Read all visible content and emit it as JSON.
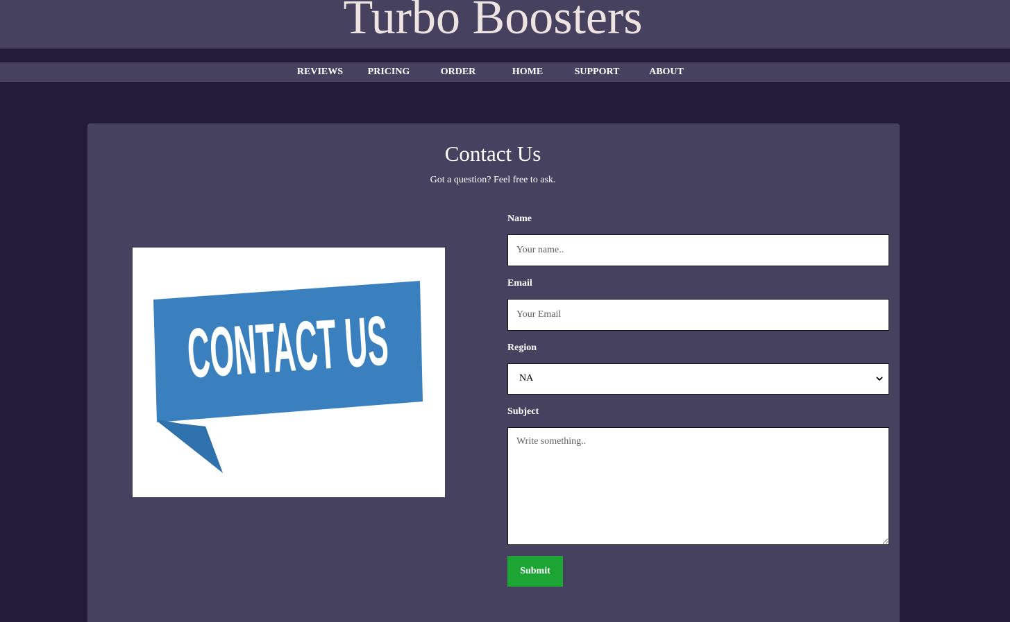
{
  "site": {
    "title": "Turbo Boosters"
  },
  "nav": {
    "items": [
      {
        "label": "REVIEWS"
      },
      {
        "label": "PRICING"
      },
      {
        "label": "ORDER"
      },
      {
        "label": "HOME"
      },
      {
        "label": "SUPPORT"
      },
      {
        "label": "ABOUT"
      }
    ]
  },
  "contact": {
    "title": "Contact Us",
    "subtitle": "Got a question? Feel free to ask.",
    "image_text": "CONTACT US",
    "form": {
      "name_label": "Name",
      "name_placeholder": "Your name..",
      "email_label": "Email",
      "email_placeholder": "Your Email",
      "region_label": "Region",
      "region_value": "NA",
      "subject_label": "Subject",
      "subject_placeholder": "Write something..",
      "submit_label": "Submit"
    }
  },
  "colors": {
    "page_background": "#221c38",
    "panel_background": "#474160",
    "title_text": "#ede3e0",
    "submit_button": "#1da534",
    "banner_blue": "#3a80bf",
    "banner_shadow": "#2a6aa3"
  },
  "icons": {
    "select": "chevron-down-icon"
  }
}
